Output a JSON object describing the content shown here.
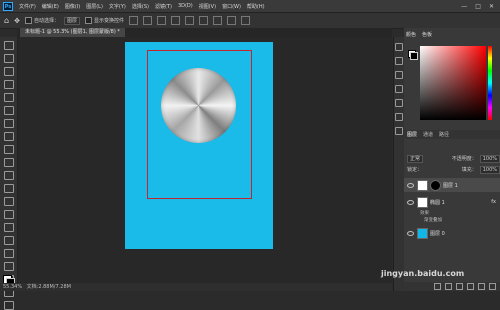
{
  "app": {
    "logo": "Ps"
  },
  "menu": [
    "文件(F)",
    "编辑(E)",
    "图像(I)",
    "图层(L)",
    "文字(Y)",
    "选择(S)",
    "滤镜(T)",
    "3D(D)",
    "视图(V)",
    "窗口(W)",
    "帮助(H)"
  ],
  "window_controls": [
    "—",
    "□",
    "✕"
  ],
  "options": {
    "auto_select_label": "自动选择：",
    "auto_select_value": "图层",
    "show_transform_label": "显示变换控件"
  },
  "document_tab": "未标题-1 @ 55.3% (图层1, 图层蒙版/8) *",
  "status": {
    "zoom": "55.34%",
    "doc_size": "文档:2.88M/7.28M"
  },
  "color_panel": {
    "tab_color": "颜色",
    "tab_swatches": "色板"
  },
  "layers_panel": {
    "tabs": [
      "图层",
      "通道",
      "路径"
    ],
    "blend_mode": "正常",
    "opacity_label": "不透明度：",
    "opacity_value": "100%",
    "lock_label": "锁定：",
    "fill_label": "填充：",
    "fill_value": "100%",
    "layers": [
      {
        "name": "图层 1",
        "thumb": "#ffffff"
      },
      {
        "name": "椭圆 1",
        "thumb": "#ffffff"
      },
      {
        "name": "图层 0",
        "thumb": "#11b7e8"
      }
    ],
    "effects_label": "效果",
    "effect_item": "渐变叠加"
  },
  "colors": {
    "canvas_fill": "#11b7e8",
    "selection": "#c1272d",
    "ps_blue": "#31a8ff"
  },
  "watermark": "jingyan.baidu.com"
}
